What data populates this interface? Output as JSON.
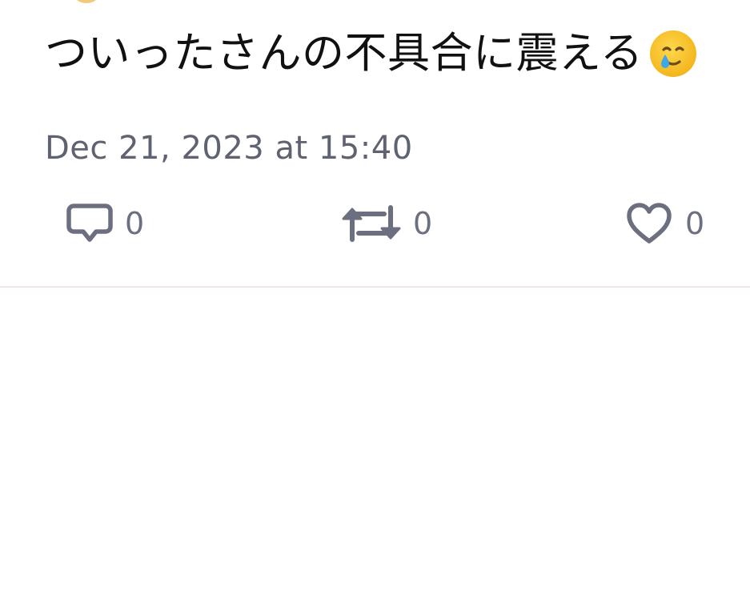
{
  "post": {
    "text": "ついったさんの不具合に震える",
    "emoji_icon": "smiling-face-with-tear-icon",
    "timestamp": "Dec 21, 2023 at 15:40"
  },
  "actions": {
    "reply": {
      "icon": "speech-bubble-icon",
      "count": "0"
    },
    "repost": {
      "icon": "repost-arrows-icon",
      "count": "0"
    },
    "like": {
      "icon": "heart-icon",
      "count": "0"
    }
  },
  "colors": {
    "text": "#111111",
    "meta": "#5f6270",
    "icon": "#6b6f80",
    "divider": "#f2e6e9",
    "emoji_face": "#f7c22c",
    "emoji_tear": "#3fa6e8"
  }
}
